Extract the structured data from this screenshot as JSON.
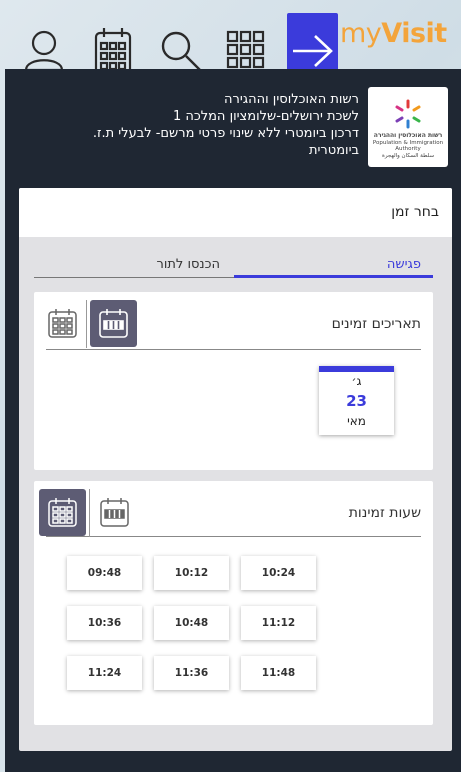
{
  "brand": {
    "prefix": "my",
    "name": "Visit"
  },
  "nav": {
    "icons": [
      "profile-icon",
      "calendar-icon",
      "search-icon",
      "apps-grid-icon",
      "arrow-right-icon"
    ]
  },
  "org": {
    "logo_text_he": "רשות האוכלוסין וההגירה",
    "logo_text_en": "Population & Immigration Authority",
    "logo_text_ar": "سلطة السكان والهجرة",
    "name": "רשות האוכלוסין וההגירה",
    "branch": "לשכת ירושלים-שלומציון המלכה 1",
    "service_line1": "דרכון ביומטרי ללא שינוי פרטי מרשם- לבעלי ת.ז.",
    "service_line2": "ביומטרית"
  },
  "page": {
    "heading": "בחר זמן"
  },
  "tabs": {
    "meeting": "פגישה",
    "queue": "הכנסו לתור"
  },
  "dates": {
    "title": "תאריכים זמינים",
    "items": [
      {
        "weekday": "ג׳",
        "day": "23",
        "month": "מאי"
      }
    ]
  },
  "times": {
    "title": "שעות זמינות",
    "slots": [
      "10:24",
      "10:12",
      "09:48",
      "11:12",
      "10:48",
      "10:36",
      "11:48",
      "11:36",
      "11:24"
    ]
  },
  "colors": {
    "accent": "#3b3bdb",
    "brand": "#f3a43b",
    "panel": "#1f2733",
    "view_active": "#5d5c74"
  }
}
